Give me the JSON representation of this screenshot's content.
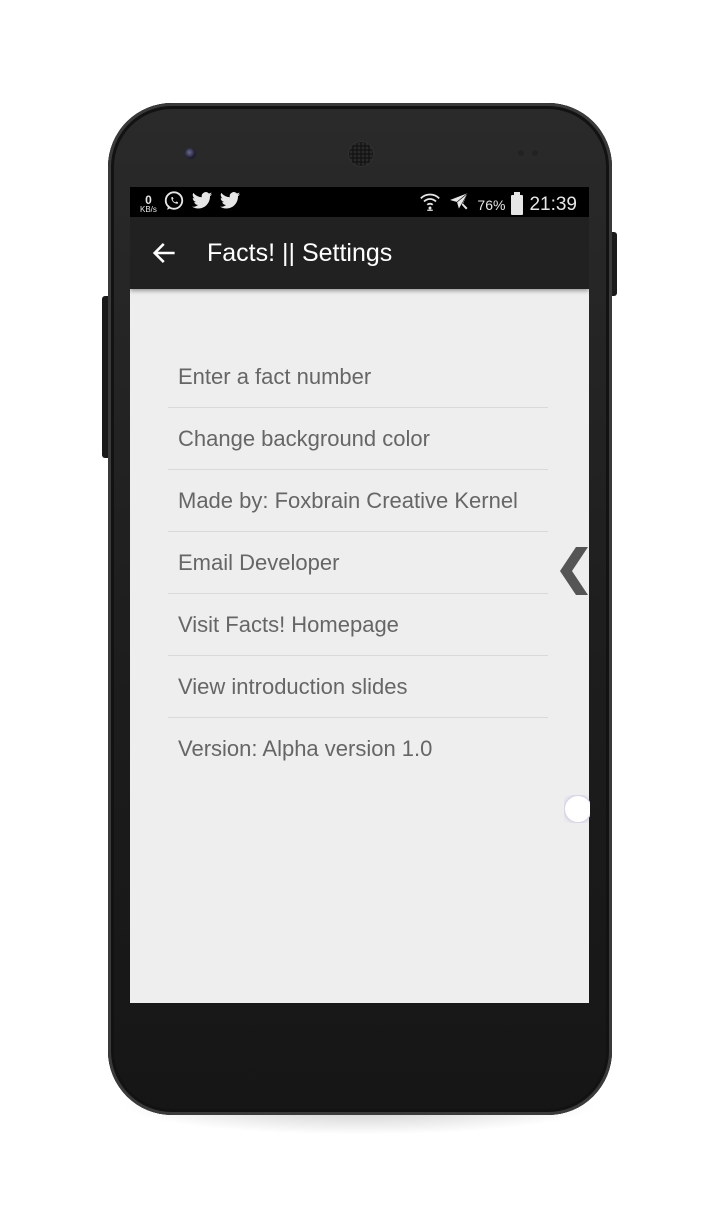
{
  "status_bar": {
    "net_speed_value": "0",
    "net_speed_unit": "KB/s",
    "notification_icons": [
      "whatsapp-icon",
      "twitter-icon",
      "twitter-icon"
    ],
    "right_icons": [
      "wifi-icon",
      "airplane-mode-icon"
    ],
    "battery_percent": "76%",
    "time": "21:39"
  },
  "app_bar": {
    "back_icon": "arrow-left-icon",
    "title": "Facts! || Settings"
  },
  "settings": {
    "items": [
      {
        "label": "Enter a fact number"
      },
      {
        "label": "Change background color"
      },
      {
        "label": "Made by: Foxbrain Creative Kernel"
      },
      {
        "label": "Email Developer"
      },
      {
        "label": "Visit Facts! Homepage"
      },
      {
        "label": "View introduction slides"
      },
      {
        "label": "Version: Alpha version 1.0"
      }
    ]
  },
  "overlays": {
    "drawer_handle_icon": "chevron-left-icon",
    "floating_button_icon": "circle-icon"
  },
  "colors": {
    "app_bar": "#212121",
    "status_bar": "#000000",
    "screen_background": "#eeeeee",
    "item_text": "#666666",
    "divider": "#d9d9d9",
    "drawer_handle": "#555555"
  }
}
